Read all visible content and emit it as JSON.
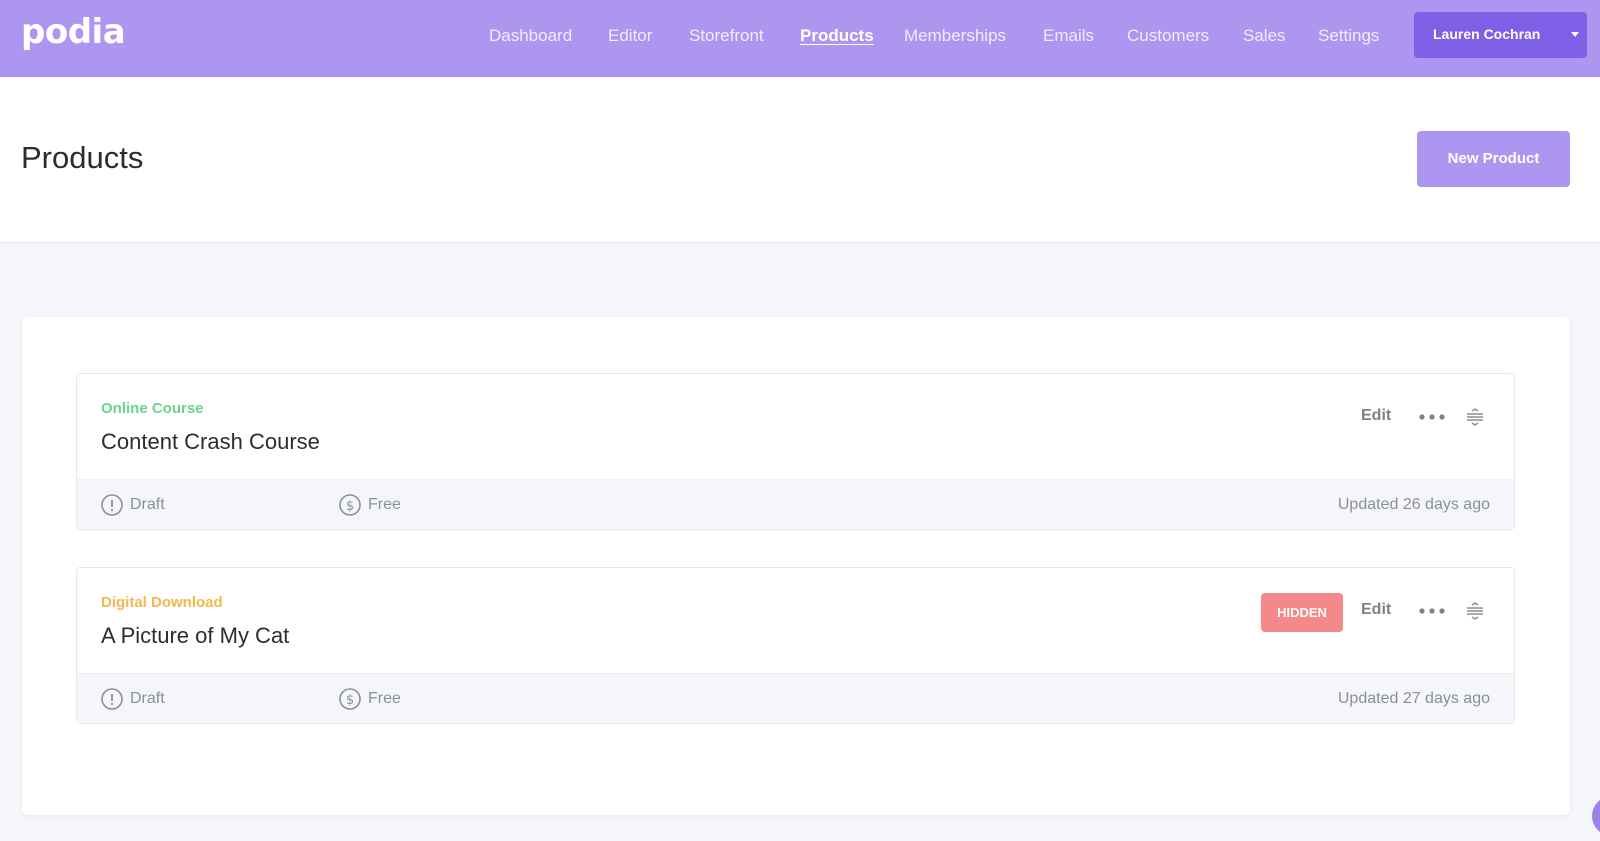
{
  "app": {
    "logo": "podia"
  },
  "nav": {
    "items": [
      {
        "label": "Dashboard"
      },
      {
        "label": "Editor"
      },
      {
        "label": "Storefront"
      },
      {
        "label": "Products",
        "active": true
      },
      {
        "label": "Memberships"
      },
      {
        "label": "Emails"
      },
      {
        "label": "Customers"
      },
      {
        "label": "Sales"
      },
      {
        "label": "Settings"
      }
    ],
    "user": {
      "name": "Lauren Cochran"
    }
  },
  "header": {
    "title": "Products",
    "new_button": "New Product"
  },
  "products": [
    {
      "type": "Online Course",
      "type_color": "#6ad48c",
      "title": "Content Crash Course",
      "status": "Draft",
      "price": "Free",
      "updated": "Updated 26 days ago",
      "edit_label": "Edit"
    },
    {
      "type": "Digital Download",
      "type_color": "#f5b74e",
      "title": "A Picture of My Cat",
      "badge": "HIDDEN",
      "status": "Draft",
      "price": "Free",
      "updated": "Updated 27 days ago",
      "edit_label": "Edit"
    }
  ],
  "colors": {
    "brand": "#ad96f0",
    "user_button": "#7f5fe6",
    "hidden_badge": "#f58888"
  },
  "icons": [
    "alert-circle-icon",
    "dollar-circle-icon",
    "more-dots-icon",
    "drag-handle-icon",
    "chevron-down-icon"
  ]
}
